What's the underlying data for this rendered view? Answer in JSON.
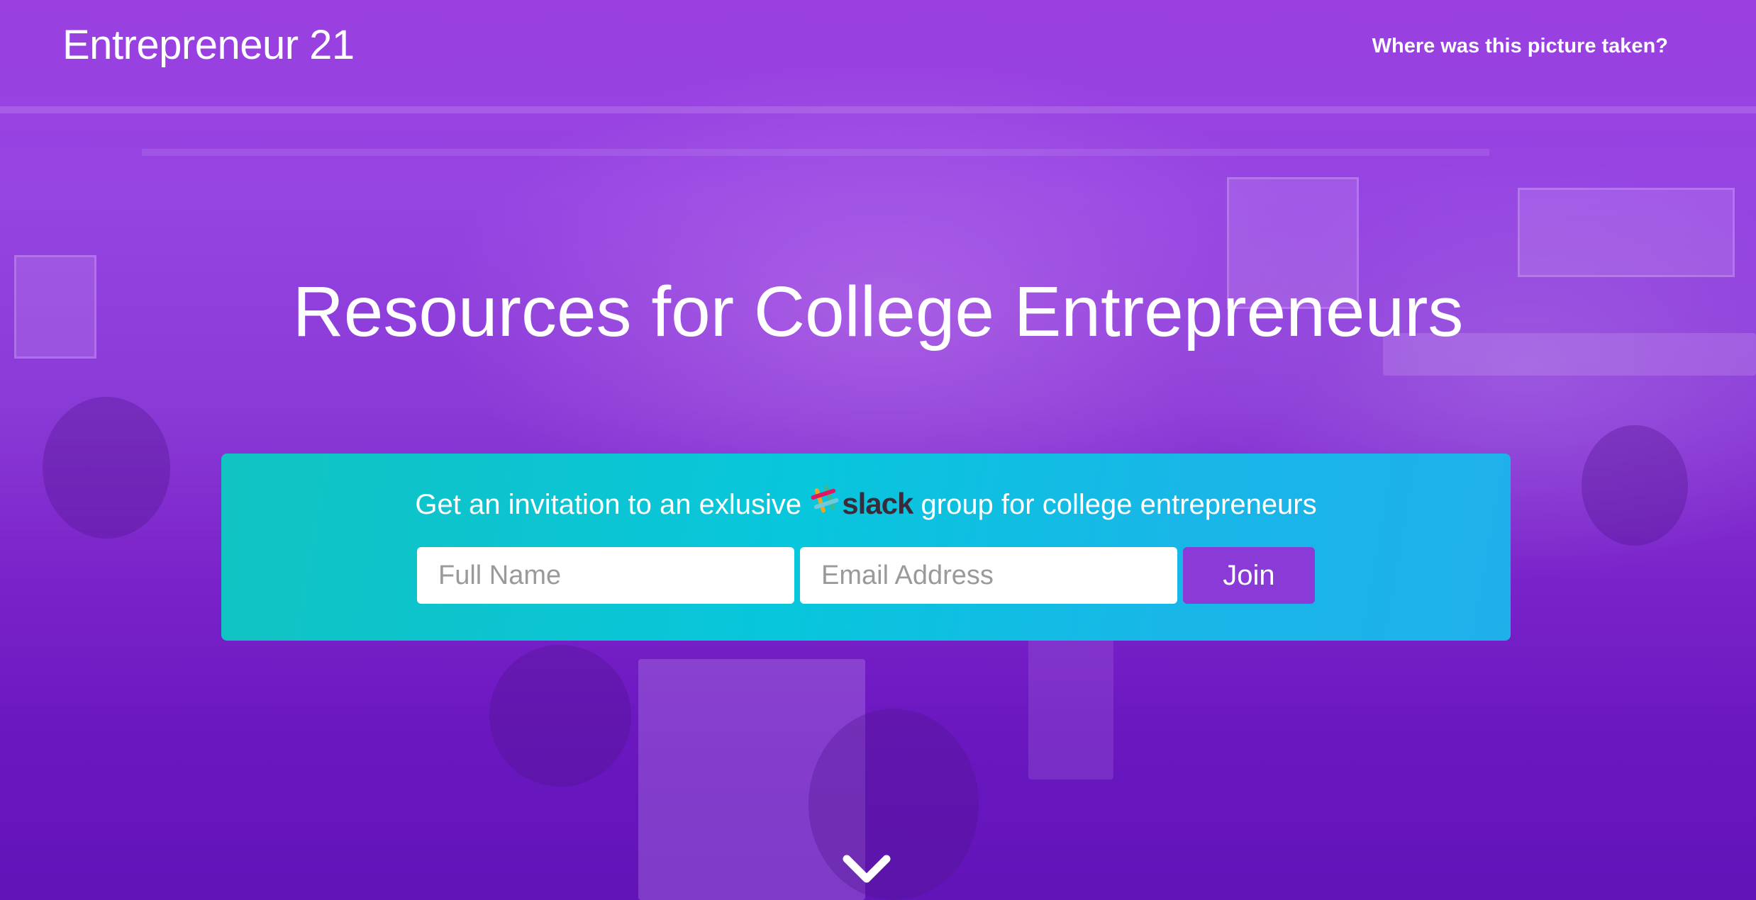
{
  "header": {
    "brand": "Entrepreneur 21",
    "photo_link": "Where was this picture taken?"
  },
  "hero": {
    "headline": "Resources for College Entrepreneurs"
  },
  "signup": {
    "invite_prefix": "Get an invitation to an exlusive",
    "slack_word": "slack",
    "invite_suffix": "group for college entrepreneurs",
    "name_placeholder": "Full Name",
    "email_placeholder": "Email Address",
    "join_label": "Join"
  },
  "icons": {
    "slack_logo": "slack-logo-icon",
    "scroll_down": "chevron-down-icon"
  },
  "colors": {
    "overlay_purple": "#8a3ad6",
    "panel_teal": "#08c6dc",
    "panel_blue": "#1fb0ea",
    "button_purple": "#8a3ad6",
    "text_white": "#ffffff"
  }
}
